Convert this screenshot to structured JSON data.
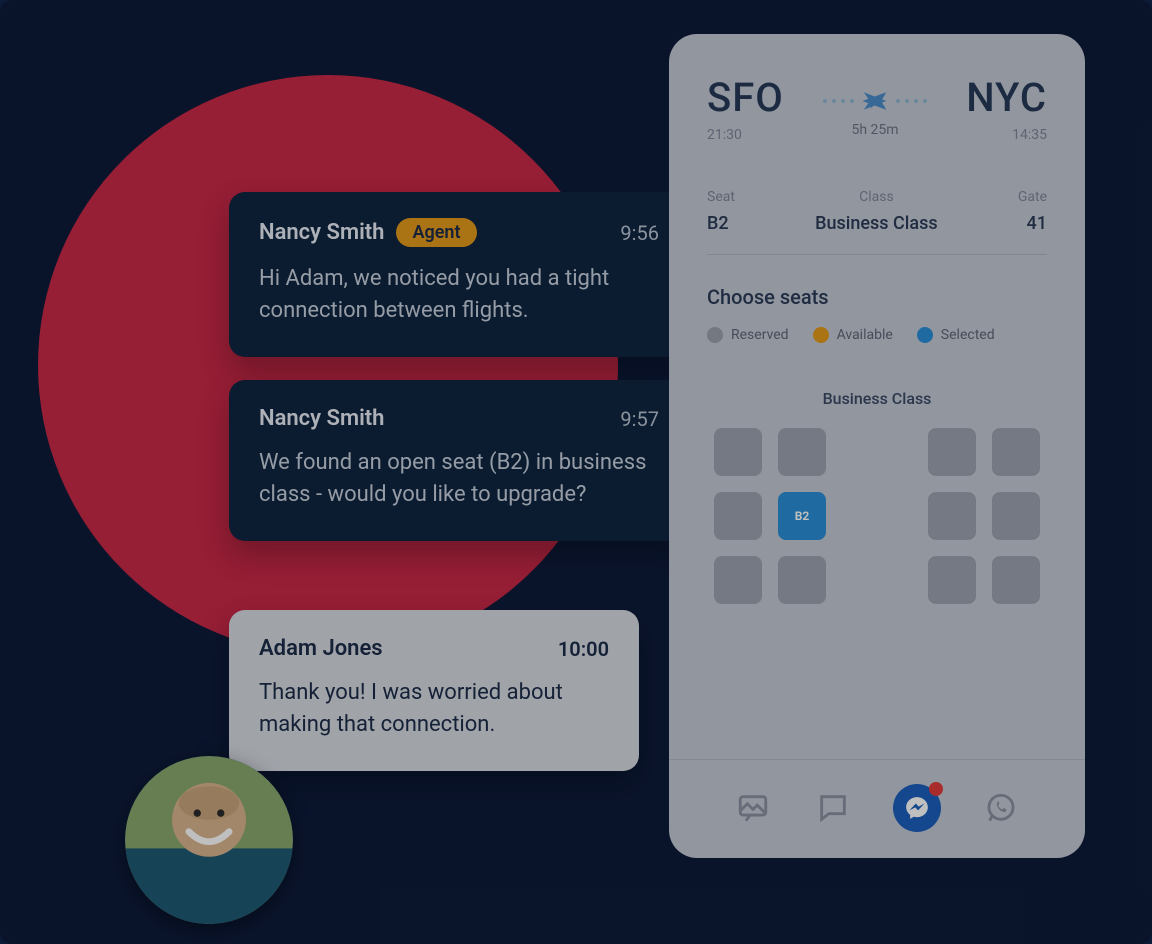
{
  "chat": {
    "messages": [
      {
        "sender": "Nancy Smith",
        "badge": "Agent",
        "time": "9:56",
        "body": "Hi Adam, we noticed you had a tight connection between flights."
      },
      {
        "sender": "Nancy Smith",
        "time": "9:57",
        "body": "We found an open seat (B2) in business class - would you like to upgrade?"
      },
      {
        "sender": "Adam Jones",
        "time": "10:00",
        "body": "Thank you! I was worried about making that connection."
      }
    ]
  },
  "ticket": {
    "origin_code": "SFO",
    "origin_time": "21:30",
    "dest_code": "NYC",
    "dest_time": "14:35",
    "duration": "5h 25m",
    "seat_label": "Seat",
    "seat_value": "B2",
    "class_label": "Class",
    "class_value": "Business Class",
    "gate_label": "Gate",
    "gate_value": "41",
    "choose_title": "Choose seats",
    "legend": {
      "reserved": "Reserved",
      "available": "Available",
      "selected": "Selected"
    },
    "cabin_label": "Business Class",
    "selected_seat": "B2"
  },
  "channels": {
    "has_notification": true
  },
  "colors": {
    "bg": "#0d1b3a",
    "accent_red": "#c82847",
    "agent_badge": "#e39a1b",
    "seat_selected": "#2a8ed6",
    "messenger_blue": "#1b5fbd"
  }
}
